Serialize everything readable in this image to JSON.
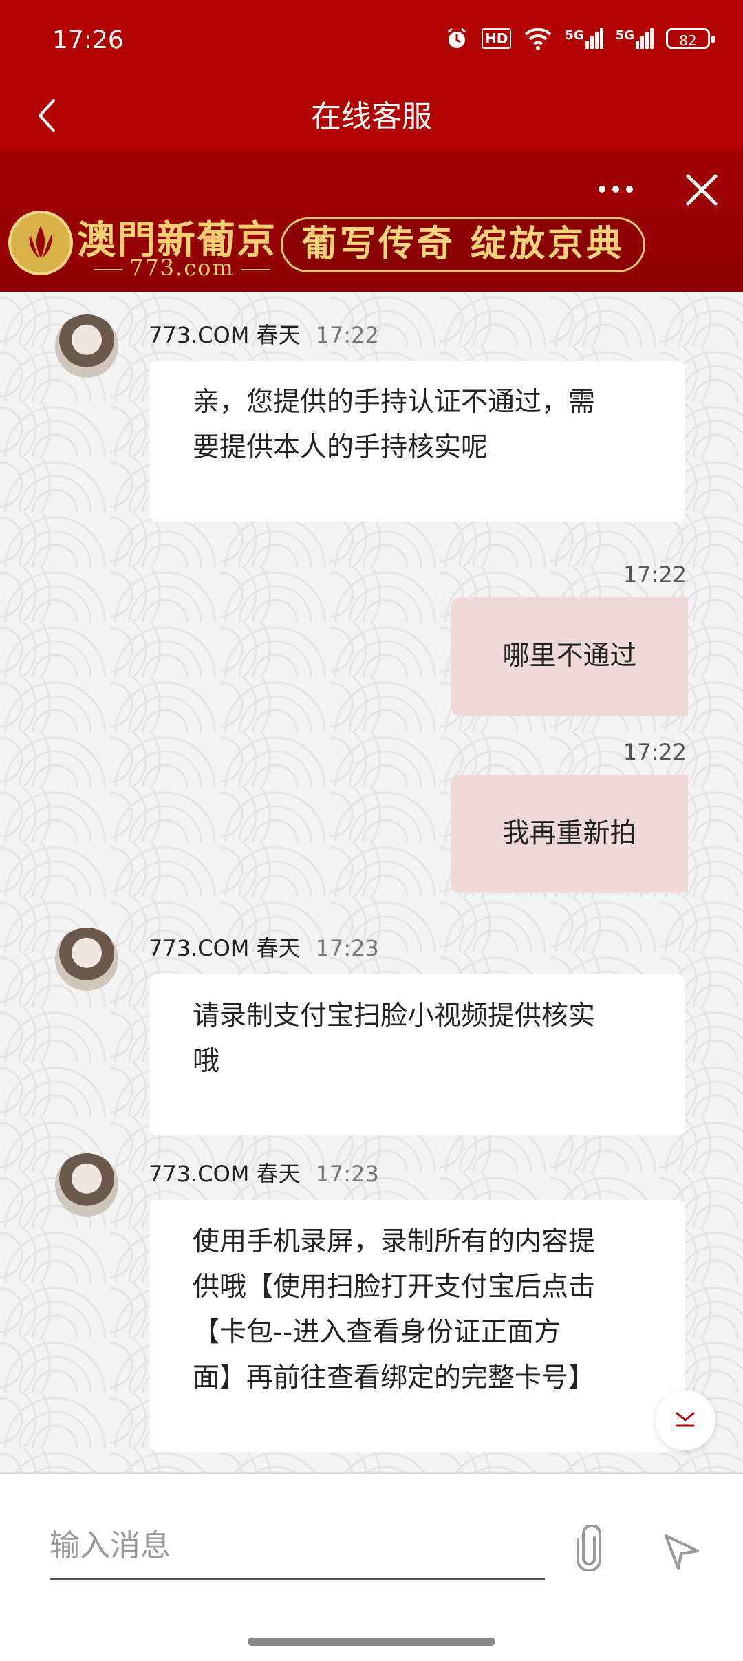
{
  "status_bar": {
    "time": "17:26",
    "battery": "82",
    "network1": "5G",
    "network2": "5G",
    "hd": "HD"
  },
  "header": {
    "title": "在线客服"
  },
  "banner": {
    "brand": "澳門新葡京",
    "domain": "773.com",
    "slogan": "葡写传奇 绽放京典"
  },
  "messages": [
    {
      "sender": "773.COM 春天",
      "time": "17:22",
      "lines": [
        "亲，您提供的手持认证不通过，需",
        "要提供本人的手持核实呢"
      ]
    },
    {
      "time": "17:22",
      "text": "哪里不通过"
    },
    {
      "time": "17:22",
      "text": "我再重新拍"
    },
    {
      "sender": "773.COM 春天",
      "time": "17:23",
      "lines": [
        "请录制支付宝扫脸小视频提供核实",
        "哦"
      ]
    },
    {
      "sender": "773.COM 春天",
      "time": "17:23",
      "lines": [
        "使用手机录屏，录制所有的内容提",
        "供哦【使用扫脸打开支付宝后点击",
        "【卡包--进入查看身份证正面方",
        "面】再前往查看绑定的完整卡号】"
      ]
    }
  ],
  "input": {
    "placeholder": "输入消息"
  },
  "colors": {
    "brand_red": "#b10202",
    "outgoing_bubble": "#f0d9d9",
    "incoming_bubble": "#ffffff"
  },
  "icons": [
    "back-icon",
    "more-icon",
    "close-icon",
    "paperclip-icon",
    "send-icon",
    "scroll-down-icon"
  ]
}
